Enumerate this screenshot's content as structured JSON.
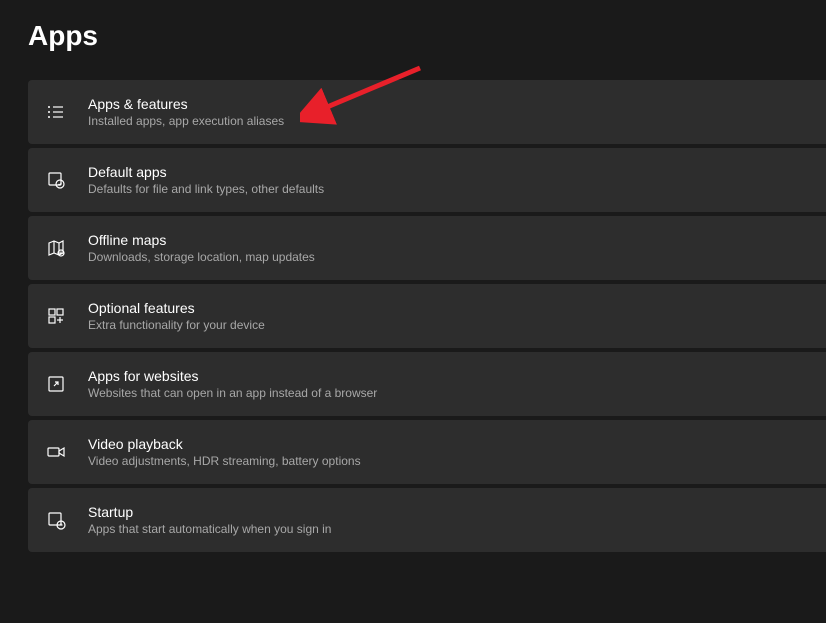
{
  "page": {
    "title": "Apps"
  },
  "items": [
    {
      "title": "Apps & features",
      "desc": "Installed apps, app execution aliases"
    },
    {
      "title": "Default apps",
      "desc": "Defaults for file and link types, other defaults"
    },
    {
      "title": "Offline maps",
      "desc": "Downloads, storage location, map updates"
    },
    {
      "title": "Optional features",
      "desc": "Extra functionality for your device"
    },
    {
      "title": "Apps for websites",
      "desc": "Websites that can open in an app instead of a browser"
    },
    {
      "title": "Video playback",
      "desc": "Video adjustments, HDR streaming, battery options"
    },
    {
      "title": "Startup",
      "desc": "Apps that start automatically when you sign in"
    }
  ],
  "annotation": {
    "type": "red-arrow",
    "target": "apps-and-features"
  }
}
